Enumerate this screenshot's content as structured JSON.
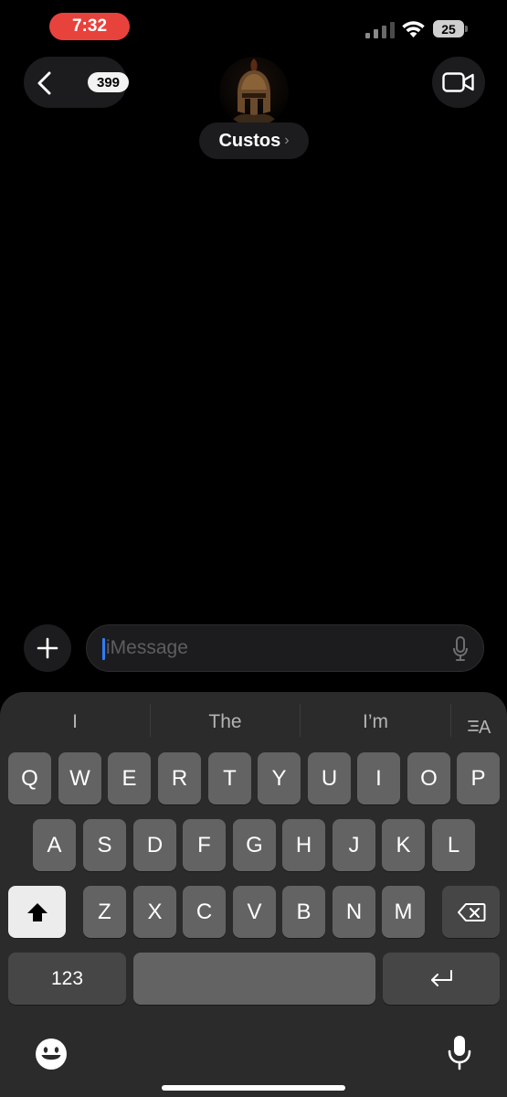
{
  "status_bar": {
    "time": "7:32",
    "battery": "25"
  },
  "header": {
    "back_count": "399",
    "contact_name": "Custos"
  },
  "compose": {
    "placeholder": "iMessage"
  },
  "keyboard": {
    "suggestions": [
      "I",
      "The",
      "I’m"
    ],
    "row1": [
      "Q",
      "W",
      "E",
      "R",
      "T",
      "Y",
      "U",
      "I",
      "O",
      "P"
    ],
    "row2": [
      "A",
      "S",
      "D",
      "F",
      "G",
      "H",
      "J",
      "K",
      "L"
    ],
    "row3": [
      "Z",
      "X",
      "C",
      "V",
      "B",
      "N",
      "M"
    ],
    "numbers_key": "123"
  },
  "colors": {
    "recording_pill": "#e8423d",
    "cursor": "#2f7cf6",
    "keyboard_bg": "#2b2b2b",
    "key": "#636363"
  },
  "icons": [
    "back-chevron-icon",
    "video-camera-icon",
    "plus-icon",
    "microphone-icon",
    "shift-icon",
    "delete-icon",
    "return-icon",
    "emoji-icon",
    "dictation-icon",
    "text-format-icon"
  ]
}
